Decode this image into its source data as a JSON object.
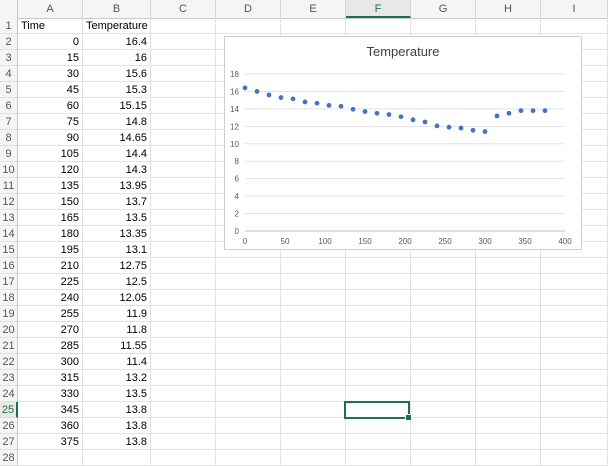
{
  "sheet": {
    "columns": [
      "A",
      "B",
      "C",
      "D",
      "E",
      "F",
      "G",
      "H",
      "I"
    ],
    "active_column": "F",
    "rows": [
      "1",
      "2",
      "3",
      "4",
      "5",
      "6",
      "7",
      "8",
      "9",
      "10",
      "11",
      "12",
      "13",
      "14",
      "15",
      "16",
      "17",
      "18",
      "19",
      "20",
      "21",
      "22",
      "23",
      "24",
      "25",
      "26",
      "27",
      "28"
    ],
    "active_row": "25",
    "headers": {
      "a1": "Time",
      "b1": "Temperature"
    },
    "data": [
      [
        "0",
        "16.4"
      ],
      [
        "15",
        "16"
      ],
      [
        "30",
        "15.6"
      ],
      [
        "45",
        "15.3"
      ],
      [
        "60",
        "15.15"
      ],
      [
        "75",
        "14.8"
      ],
      [
        "90",
        "14.65"
      ],
      [
        "105",
        "14.4"
      ],
      [
        "120",
        "14.3"
      ],
      [
        "135",
        "13.95"
      ],
      [
        "150",
        "13.7"
      ],
      [
        "165",
        "13.5"
      ],
      [
        "180",
        "13.35"
      ],
      [
        "195",
        "13.1"
      ],
      [
        "210",
        "12.75"
      ],
      [
        "225",
        "12.5"
      ],
      [
        "240",
        "12.05"
      ],
      [
        "255",
        "11.9"
      ],
      [
        "270",
        "11.8"
      ],
      [
        "285",
        "11.55"
      ],
      [
        "300",
        "11.4"
      ],
      [
        "315",
        "13.2"
      ],
      [
        "330",
        "13.5"
      ],
      [
        "345",
        "13.8"
      ],
      [
        "360",
        "13.8"
      ],
      [
        "375",
        "13.8"
      ]
    ],
    "selected_cell": "F25"
  },
  "chart_data": {
    "type": "scatter",
    "title": "Temperature",
    "xlabel": "",
    "ylabel": "",
    "xlim": [
      0,
      400
    ],
    "ylim": [
      0,
      18
    ],
    "x_ticks": [
      "0",
      "50",
      "100",
      "150",
      "200",
      "250",
      "300",
      "350",
      "400"
    ],
    "y_ticks": [
      "0",
      "2",
      "4",
      "6",
      "8",
      "10",
      "12",
      "14",
      "16",
      "18"
    ],
    "grid": true,
    "legend": "none",
    "color": "#4472C4",
    "series": [
      {
        "x": [
          0,
          15,
          30,
          45,
          60,
          75,
          90,
          105,
          120,
          135,
          150,
          165,
          180,
          195,
          210,
          225,
          240,
          255,
          270,
          285,
          300,
          315,
          330,
          345,
          360,
          375
        ],
        "y": [
          16.4,
          16,
          15.6,
          15.3,
          15.15,
          14.8,
          14.65,
          14.4,
          14.3,
          13.95,
          13.7,
          13.5,
          13.35,
          13.1,
          12.75,
          12.5,
          12.05,
          11.9,
          11.8,
          11.55,
          11.4,
          13.2,
          13.5,
          13.8,
          13.8,
          13.8
        ]
      }
    ]
  }
}
